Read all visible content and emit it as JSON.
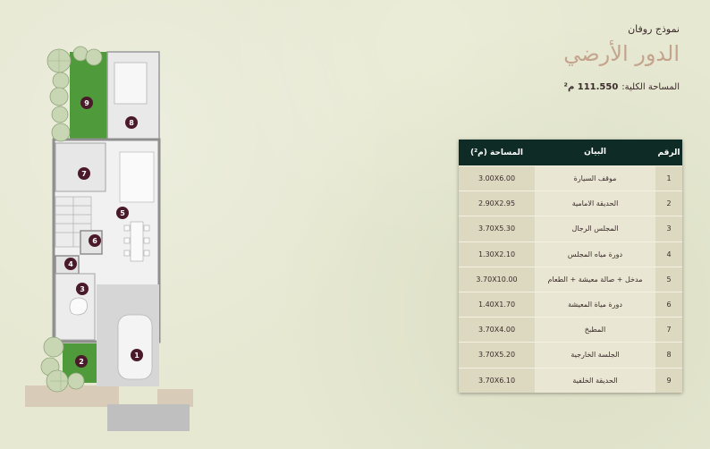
{
  "header": {
    "model_name": "نموذج روفان",
    "floor_title": "الدور الأرضي",
    "total_area_label": "المساحة الكلية:",
    "total_area_value": "111.550 م²"
  },
  "table": {
    "columns": {
      "num": "الرقم",
      "desc": "البيان",
      "area": "المساحة (م²)"
    },
    "rows": [
      {
        "num": "1",
        "desc": "موقف السيارة",
        "area": "3.00X6.00"
      },
      {
        "num": "2",
        "desc": "الحديقة الامامية",
        "area": "2.90X2.95"
      },
      {
        "num": "3",
        "desc": "المجلس الرجال",
        "area": "3.70X5.30"
      },
      {
        "num": "4",
        "desc": "دورة مياه المجلس",
        "area": "1.30X2.10"
      },
      {
        "num": "5",
        "desc": "مدخل + صالة معيشة + الطعام",
        "area": "3.70X10.00"
      },
      {
        "num": "6",
        "desc": "دورة مياة المعيشة",
        "area": "1.40X1.70"
      },
      {
        "num": "7",
        "desc": "المطبخ",
        "area": "3.70X4.00"
      },
      {
        "num": "8",
        "desc": "الجلسة الخارجية",
        "area": "3.70X5.20"
      },
      {
        "num": "9",
        "desc": "الحديقة الخلفية",
        "area": "3.70X6.10"
      }
    ]
  },
  "plan": {
    "markers": [
      "1",
      "2",
      "3",
      "4",
      "5",
      "6",
      "7",
      "8",
      "9"
    ]
  },
  "colors": {
    "background": "#e6e8d2",
    "title": "#c4a48d",
    "table_header": "#0f2b25",
    "marker": "#4a1a2a",
    "garden": "#4f9a3a"
  }
}
